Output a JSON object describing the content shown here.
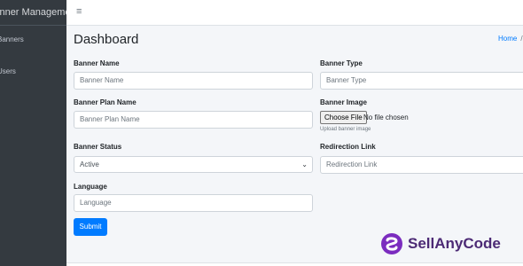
{
  "sidebar": {
    "brand": "Banner Management",
    "items": [
      {
        "label": "Banners"
      },
      {
        "label": "Users"
      }
    ]
  },
  "topbar": {
    "menu_icon": "hamburger-icon",
    "menu_glyph": "≡"
  },
  "page": {
    "title": "Dashboard",
    "breadcrumb": {
      "home": "Home",
      "separator": "/"
    }
  },
  "form": {
    "banner_name": {
      "label": "Banner Name",
      "placeholder": "Banner Name"
    },
    "banner_type": {
      "label": "Banner Type",
      "placeholder": "Banner Type"
    },
    "banner_plan_name": {
      "label": "Banner Plan Name",
      "placeholder": "Banner Plan Name"
    },
    "banner_image": {
      "label": "Banner Image",
      "button": "Choose File",
      "status": "No file chosen",
      "help": "Upload banner image"
    },
    "banner_status": {
      "label": "Banner Status",
      "selected": "Active",
      "chevron": "⌄"
    },
    "redirection_link": {
      "label": "Redirection Link",
      "placeholder": "Redirection Link"
    },
    "language": {
      "label": "Language",
      "placeholder": "Language"
    },
    "submit": "Submit"
  },
  "watermark": {
    "text": "SellAnyCode"
  },
  "colors": {
    "sidebar": "#343a40",
    "primary": "#007bff",
    "background": "#f4f6f9",
    "watermark": "#4c2a75"
  }
}
